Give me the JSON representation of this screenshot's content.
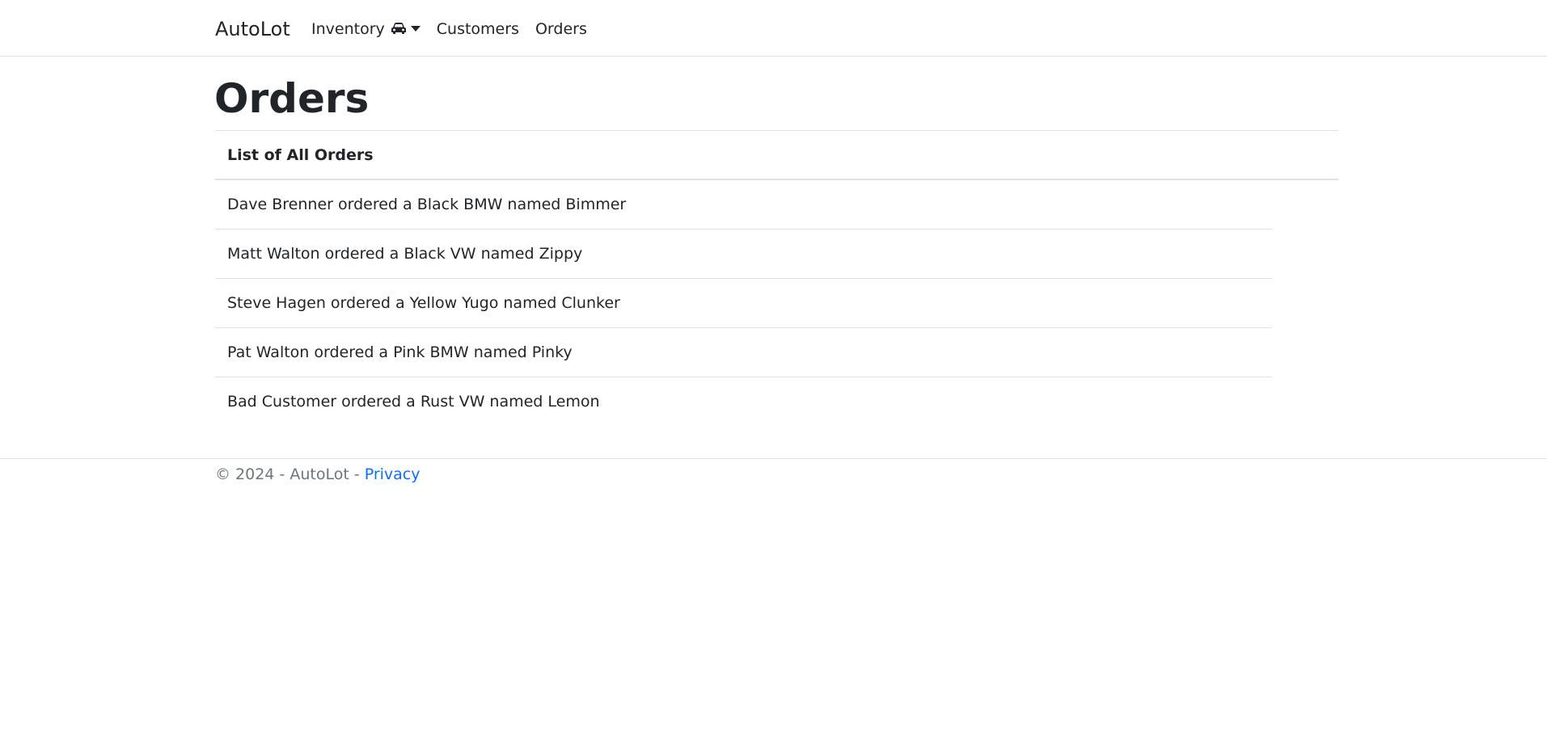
{
  "navbar": {
    "brand": "AutoLot",
    "items": [
      {
        "label": "Inventory",
        "icon": "car-icon",
        "has_dropdown": true
      },
      {
        "label": "Customers"
      },
      {
        "label": "Orders"
      }
    ]
  },
  "page": {
    "title": "Orders"
  },
  "table": {
    "header": "List of All Orders",
    "rows": [
      "Dave Brenner ordered a Black BMW named Bimmer",
      "Matt Walton ordered a Black VW named Zippy",
      "Steve Hagen ordered a Yellow Yugo named Clunker",
      "Pat Walton ordered a Pink BMW named Pinky",
      "Bad Customer ordered a Rust VW named Lemon"
    ]
  },
  "footer": {
    "copyright": "© 2024 - AutoLot - ",
    "privacy_link": "Privacy",
    "link_color": "#0d6efd"
  }
}
